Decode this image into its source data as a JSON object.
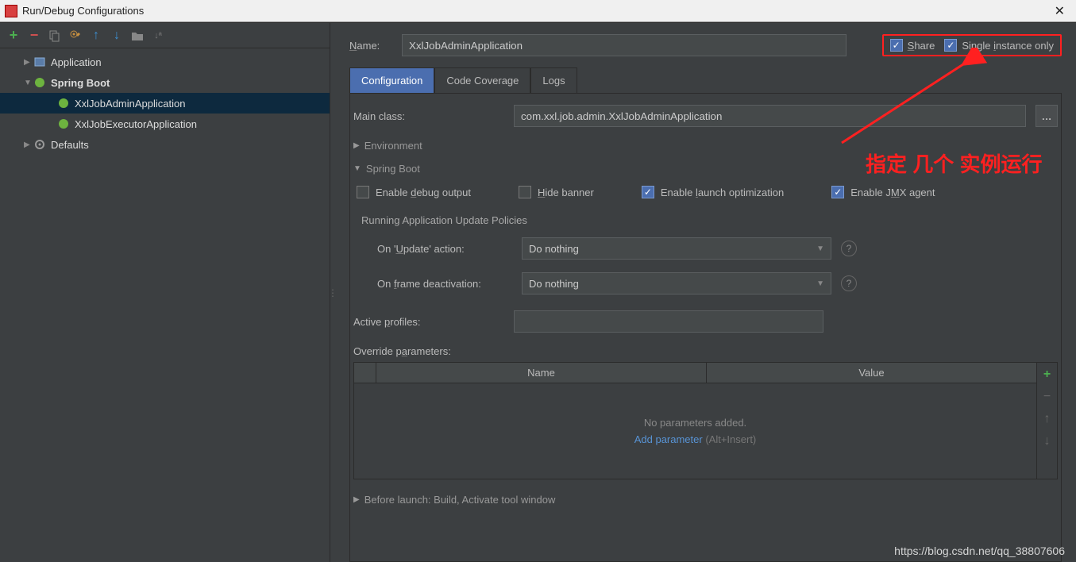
{
  "window": {
    "title": "Run/Debug Configurations"
  },
  "toolbar_icons": [
    "plus",
    "minus",
    "copy",
    "wrench",
    "up",
    "down",
    "folder",
    "sort"
  ],
  "tree": {
    "application": {
      "label": "Application"
    },
    "springboot": {
      "label": "Spring Boot"
    },
    "item1": {
      "label": "XxlJobAdminApplication"
    },
    "item2": {
      "label": "XxlJobExecutorApplication"
    },
    "defaults": {
      "label": "Defaults"
    }
  },
  "name_label": "Name:",
  "name_value": "XxlJobAdminApplication",
  "share_label": "Share",
  "single_label": "Single instance only",
  "tabs": {
    "config": "Configuration",
    "coverage": "Code Coverage",
    "logs": "Logs"
  },
  "main_class_label": "Main class:",
  "main_class_value": "com.xxl.job.admin.XxlJobAdminApplication",
  "env_label": "Environment",
  "springboot_label": "Spring Boot",
  "opts": {
    "debug": "Enable debug output",
    "hide": "Hide banner",
    "launch": "Enable launch optimization",
    "jmx": "Enable JMX agent"
  },
  "policies_hdr": "Running Application Update Policies",
  "on_update_label": "On 'Update' action:",
  "on_update_value": "Do nothing",
  "on_frame_label": "On frame deactivation:",
  "on_frame_value": "Do nothing",
  "active_profiles_label": "Active profiles:",
  "override_label": "Override parameters:",
  "table": {
    "col1": "Name",
    "col2": "Value",
    "empty": "No parameters added.",
    "add": "Add parameter",
    "hint": " (Alt+Insert)"
  },
  "before_launch": "Before launch: Build, Activate tool window",
  "annotation": "指定 几个 实例运行",
  "watermark": "https://blog.csdn.net/qq_38807606"
}
